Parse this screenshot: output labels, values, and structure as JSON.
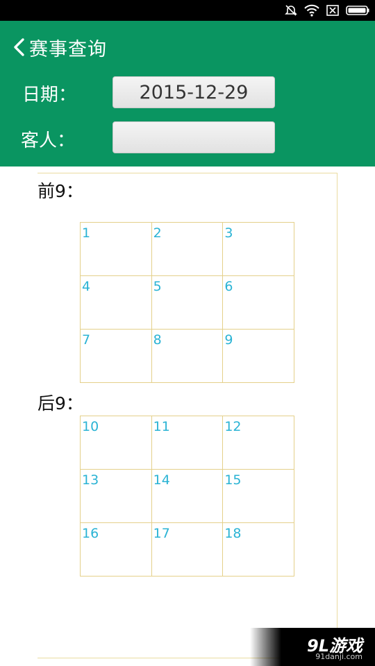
{
  "header": {
    "title": "赛事查询",
    "date_label": "日期：",
    "date_value": "2015-12-29",
    "guest_label": "客人：",
    "guest_value": ""
  },
  "front_nine": {
    "label": "前9：",
    "holes": [
      "1",
      "2",
      "3",
      "4",
      "5",
      "6",
      "7",
      "8",
      "9"
    ]
  },
  "back_nine": {
    "label": "后9：",
    "holes": [
      "10",
      "11",
      "12",
      "13",
      "14",
      "15",
      "16",
      "17",
      "18"
    ]
  },
  "watermark": {
    "logo": "9L游戏",
    "url": "91danji.com"
  },
  "colors": {
    "header_bg": "#0a9561",
    "hole_number": "#2ab3d4",
    "grid_border": "#e4d08a"
  }
}
